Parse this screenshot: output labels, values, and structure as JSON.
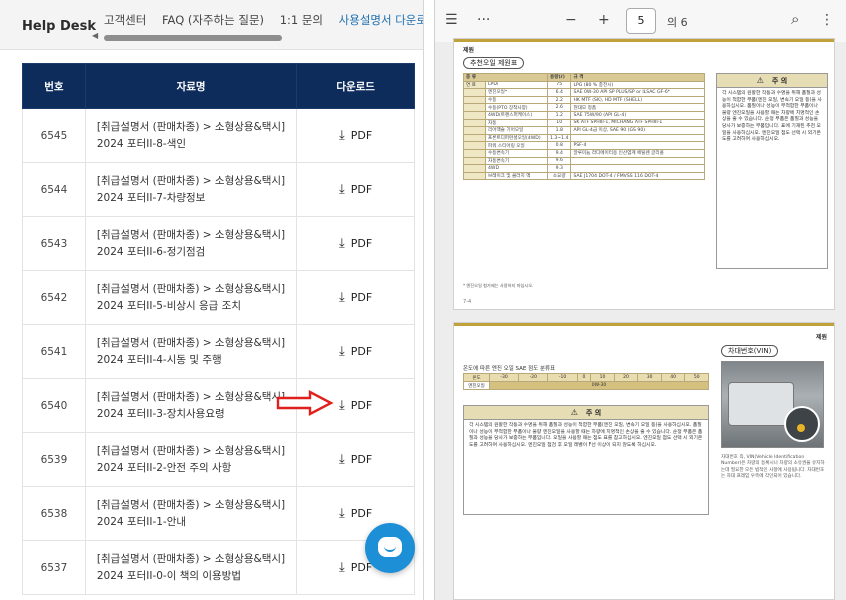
{
  "left": {
    "logo": "Help Desk",
    "nav": [
      "고객센터",
      "FAQ (자주하는 질문)",
      "1:1 문의",
      "사용설명서 다운로드"
    ],
    "table": {
      "headers": [
        "번호",
        "자료명",
        "다운로드"
      ],
      "rows": [
        {
          "num": "6545",
          "line1": "[취급설명서 (판매차종) > 소형상용&택시]",
          "line2": "2024 포터II-8-색인",
          "dl": "PDF"
        },
        {
          "num": "6544",
          "line1": "[취급설명서 (판매차종) > 소형상용&택시]",
          "line2": "2024 포터II-7-차량정보",
          "dl": "PDF"
        },
        {
          "num": "6543",
          "line1": "[취급설명서 (판매차종) > 소형상용&택시]",
          "line2": "2024 포터II-6-정기점검",
          "dl": "PDF"
        },
        {
          "num": "6542",
          "line1": "[취급설명서 (판매차종) > 소형상용&택시]",
          "line2": "2024 포터II-5-비상시 응급 조치",
          "dl": "PDF"
        },
        {
          "num": "6541",
          "line1": "[취급설명서 (판매차종) > 소형상용&택시]",
          "line2": "2024 포터II-4-시동 및 주행",
          "dl": "PDF"
        },
        {
          "num": "6540",
          "line1": "[취급설명서 (판매차종) > 소형상용&택시]",
          "line2": "2024 포터II-3-장치사용요령",
          "dl": "PDF"
        },
        {
          "num": "6539",
          "line1": "[취급설명서 (판매차종) > 소형상용&택시]",
          "line2": "2024 포터II-2-안전 주의 사항",
          "dl": "PDF"
        },
        {
          "num": "6538",
          "line1": "[취급설명서 (판매차종) > 소형상용&택시]",
          "line2": "2024 포터II-1-안내",
          "dl": "PDF"
        },
        {
          "num": "6537",
          "line1": "[취급설명서 (판매차종) > 소형상용&택시]",
          "line2": "2024 포터II-0-이 책의 이용방법",
          "dl": "PDF"
        }
      ]
    }
  },
  "right": {
    "toolbar": {
      "page": "5",
      "total": "의 6"
    },
    "page1": {
      "section": "제원",
      "fluids_title": "추천오일 제원표",
      "fluid_headers": [
        "종 류",
        "용량(ℓ)",
        "규 격"
      ],
      "fluid_rows": [
        [
          "연 료",
          "LPDi",
          "75",
          "LPG (80 % 충전시)"
        ],
        [
          "",
          "엔진오일*",
          "6.4",
          "SAE 0W-30 API SP PLUS/SP or ILSAC GF-6*"
        ],
        [
          "",
          "수동",
          "2.2",
          "HK MTF (SK), HD MTF (SHELL)"
        ],
        [
          "",
          "수동(PTO 장착사양)",
          "2.6",
          "현대모 정품"
        ],
        [
          "",
          "4WD(트랜스퍼케이스)",
          "1.2",
          "SAE 75W/90 (API GL-4)"
        ],
        [
          "",
          "자동",
          "10",
          "SK ATF SPHIII-1, MICHANG ATF SPHIII-1"
        ],
        [
          "",
          "리어액슬 기어오일",
          "1.8",
          "API GL-4급 이상, SAE 90 (GS 90)"
        ],
        [
          "",
          "프론트디퍼런셜오일(4WD)",
          "1.3~1.4",
          ""
        ],
        [
          "",
          "파워 스티어링 오일",
          "0.8",
          "PSF-4"
        ],
        [
          "",
          "수동변속기",
          "9.4",
          "알루미늄 라디에이터용 인산염계 에틸렌 글리콜"
        ],
        [
          "",
          "자동변속기",
          "9.6",
          ""
        ],
        [
          "",
          "4WD",
          "9.3",
          ""
        ],
        [
          "",
          "브레이크 및 클러치 액",
          "소요량",
          "SAE J1704 DOT-4 / FMVSS 116 DOT-4"
        ]
      ],
      "note": "* 엔진오일 첨가제는 사용하지 마십시오.",
      "caution_title": "주 의",
      "caution_text": "각 시스템의 원활한 작동과 수명을 위해 품질과 성능이 적합한 부품(엔진 오일, 변속기 오일 등)을 사용하십시오. 품질이나 성능이 부적합한 부품이나 불량 엔진오일을 사용할 때는 차량에 치명적인 손상을 줄 수 있습니다. 순정 부품은 품질과 성능을 당사가 보증하는 부품입니다. 표에 기재된 추천 오일을 사용하십시오. 엔진오일 점도 선택 시 외기온도를 고려하여 사용하십시오.",
      "page_no": "7-4"
    },
    "page2": {
      "section": "제원",
      "visc_title": "온도에 따른 엔진 오일 SAE 점도 분류표",
      "visc_temp_label": "온도",
      "visc_temps": [
        "-30",
        "-20",
        "-10",
        "0",
        "10",
        "20",
        "30",
        "40",
        "50"
      ],
      "visc_oil_label": "엔진오일",
      "visc_grade": "0W-30",
      "caution_title": "주 의",
      "caution_text": "각 시스템의 원활한 작동과 수명을 위해 품질과 성능이 적합한 부품(엔진 오일, 변속기 오일 등)을 사용하십시오. 품질이나 성능이 부적합한 부품이나 불량 엔진오일을 사용할 때는 차량에 치명적인 손상을 줄 수 있습니다. 순정 부품은 품질과 성능을 당사가 보증하는 부품입니다. 오일을 사용할 때는 점도 표를 참고하십시오. 엔진오일 점도 선택 시 외기온도를 고려하여 사용하십시오. 엔진오일 점검 후 오일 레벨이 F선 이상이 되지 않도록 하십시오.",
      "vin_title": "차대번호(VIN)",
      "vin_text": "차대번호 즉, VIN(Vehicle Identification Number)은 차량의 등록시나 차량의 소유권을 유지하는데 필요한 모든 법적인 사항에 사용됩니다. 차대번호는 차대 프레임 우측에 각인되어 있습니다."
    }
  }
}
